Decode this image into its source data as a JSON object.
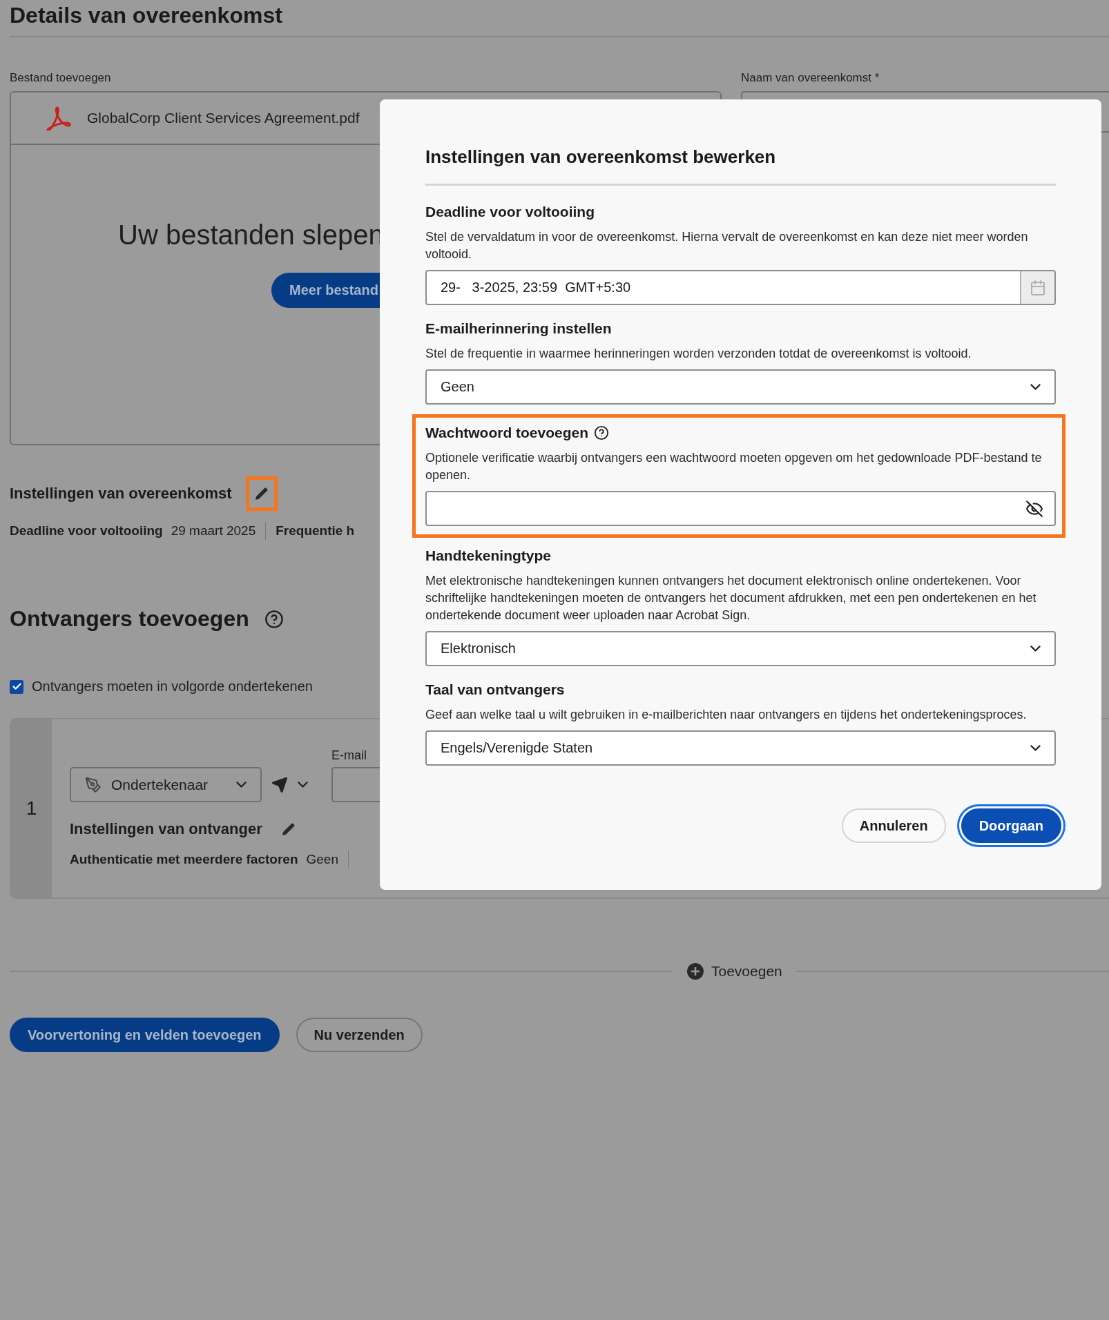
{
  "page": {
    "title": "Details van overeenkomst",
    "file_section": {
      "label": "Bestand toevoegen",
      "file_name": "GlobalCorp Client Services Agreement.pdf",
      "drop_text": "Uw bestanden slepen",
      "more_button": "Meer bestand"
    },
    "name_field": {
      "label": "Naam van overeenkomst",
      "required_mark": "*"
    },
    "settings": {
      "title": "Instellingen van overeenkomst",
      "edit_highlighted": true,
      "items": [
        {
          "label": "Deadline voor voltooiing",
          "value": "29 maart 2025"
        },
        {
          "label": "Frequentie h"
        }
      ]
    },
    "recipients": {
      "title": "Ontvangers toevoegen",
      "order_checkbox": {
        "label": "Ontvangers moeten in volgorde ondertekenen",
        "checked": true
      },
      "list": [
        {
          "number": "1",
          "role": "Ondertekenaar",
          "email_label": "E-mail",
          "settings_title": "Instellingen van ontvanger",
          "auth_label": "Authenticatie met meerdere factoren",
          "auth_value": "Geen"
        }
      ],
      "add_label": "Toevoegen"
    },
    "actions": [
      {
        "label": "Voorvertoning en velden toevoegen",
        "kind": "primary"
      },
      {
        "label": "Nu verzenden",
        "kind": "secondary"
      }
    ]
  },
  "dialog": {
    "title": "Instellingen van overeenkomst bewerken",
    "sections": [
      {
        "kind": "datetime",
        "title": "Deadline voor voltooiing",
        "description": "Stel de vervaldatum in voor de overeenkomst. Hierna vervalt de overeenkomst en kan deze niet meer worden voltooid.",
        "value": "29-   3-2025, 23:59  GMT+5:30",
        "highlighted": false
      },
      {
        "kind": "select",
        "title": "E-mailherinnering instellen",
        "description": "Stel de frequentie in waarmee herinneringen worden verzonden totdat de overeenkomst is voltooid.",
        "value": "Geen",
        "highlighted": false
      },
      {
        "kind": "password",
        "title": "Wachtwoord toevoegen",
        "help": true,
        "description": "Optionele verificatie waarbij ontvangers een wachtwoord moeten opgeven om het gedownloade PDF-bestand te openen.",
        "highlighted": true
      },
      {
        "kind": "select",
        "title": "Handtekeningtype",
        "description": "Met elektronische handtekeningen kunnen ontvangers het document elektronisch online ondertekenen. Voor schriftelijke handtekeningen moeten de ontvangers het document afdrukken, met een pen ondertekenen en het ondertekende document weer uploaden naar Acrobat Sign.",
        "value": "Elektronisch",
        "highlighted": false
      },
      {
        "kind": "select",
        "title": "Taal van ontvangers",
        "description": "Geef aan welke taal u wilt gebruiken in e-mailberichten naar ontvangers en tijdens het ondertekeningsproces.",
        "value": "Engels/Verenigde Staten",
        "highlighted": false
      }
    ],
    "buttons": [
      {
        "label": "Annuleren",
        "kind": "secondary",
        "focused": false
      },
      {
        "label": "Doorgaan",
        "kind": "primary",
        "focused": true
      }
    ]
  }
}
